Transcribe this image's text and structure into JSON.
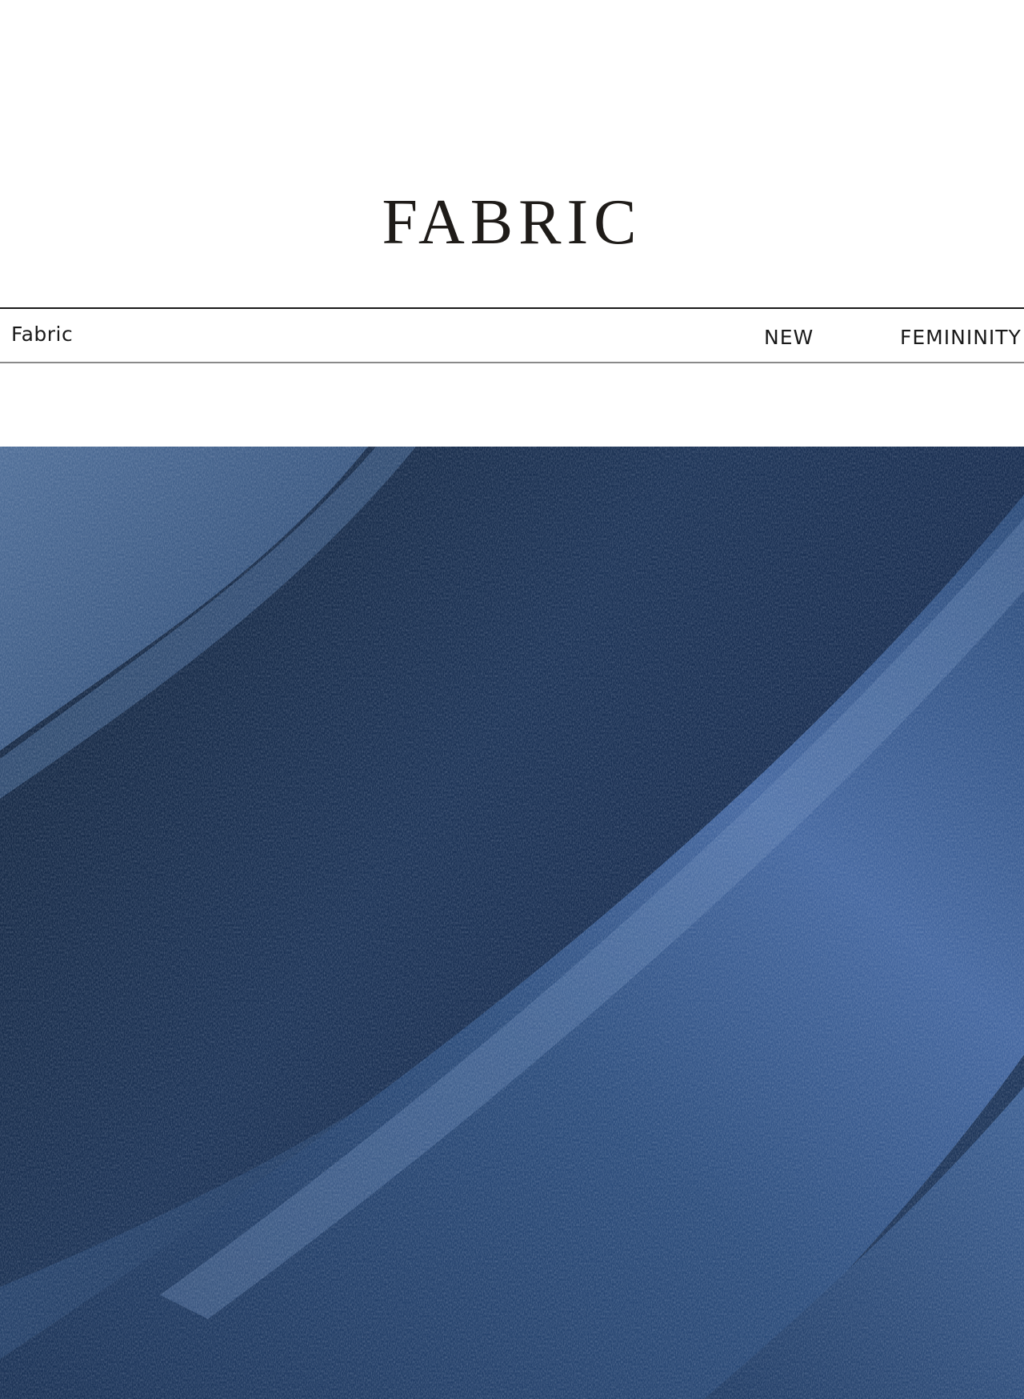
{
  "heading": {
    "title": "FABRIC"
  },
  "info_bar": {
    "left_label": "Fabric",
    "right_labels": [
      "NEW",
      "FEMININITY"
    ]
  },
  "photo": {
    "subject": "denim-fabric-folds",
    "colors": {
      "dark": "#14263f",
      "mid": "#2b4a75",
      "light": "#5f7ea8"
    }
  }
}
